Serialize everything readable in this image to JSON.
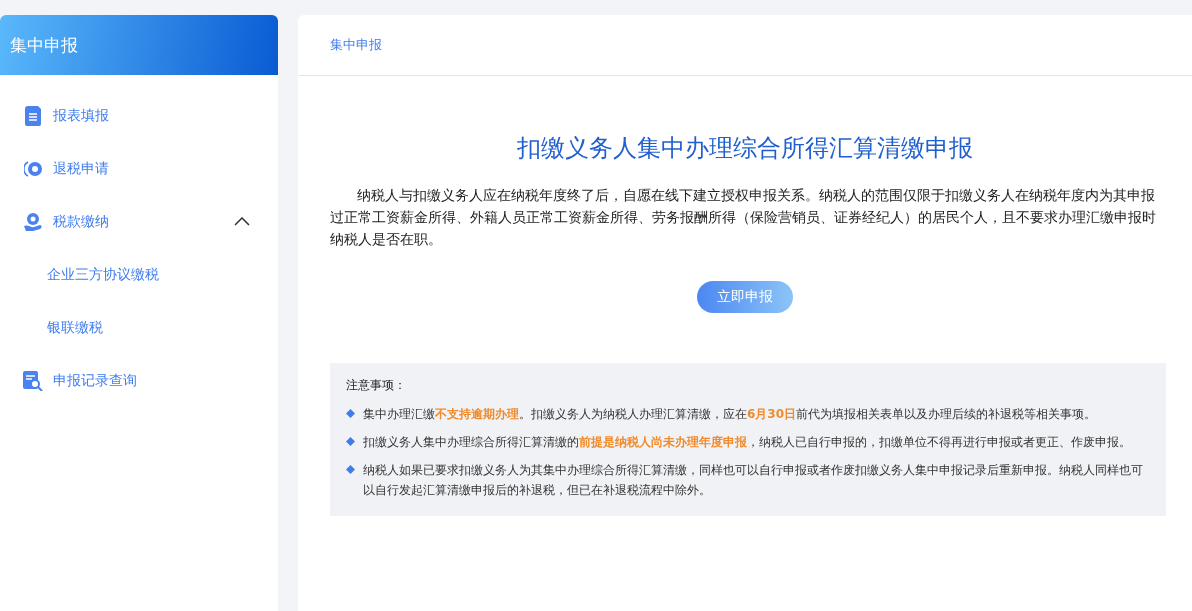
{
  "sidebar": {
    "title": "集中申报",
    "items": [
      {
        "label": "报表填报"
      },
      {
        "label": "退税申请"
      },
      {
        "label": "税款缴纳",
        "expanded": true,
        "children": [
          {
            "label": "企业三方协议缴税"
          },
          {
            "label": "银联缴税"
          }
        ]
      },
      {
        "label": "申报记录查询"
      }
    ]
  },
  "breadcrumb": "集中申报",
  "main": {
    "title": "扣缴义务人集中办理综合所得汇算清缴申报",
    "intro": "纳税人与扣缴义务人应在纳税年度终了后，自愿在线下建立授权申报关系。纳税人的范围仅限于扣缴义务人在纳税年度内为其申报过正常工资薪金所得、外籍人员正常工资薪金所得、劳务报酬所得（保险营销员、证券经纪人）的居民个人，且不要求办理汇缴申报时纳税人是否在职。",
    "button": "立即申报",
    "notice": {
      "title": "注意事项：",
      "items": [
        "集中办理汇缴**不支持逾期办理**。扣缴义务人为纳税人办理汇算清缴，应在**6月30日**前代为填报相关表单以及办理后续的补退税等相关事项。",
        "扣缴义务人集中办理综合所得汇算清缴的**前提是纳税人尚未办理年度申报**，纳税人已自行申报的，扣缴单位不得再进行申报或者更正、作废申报。",
        "纳税人如果已要求扣缴义务人为其集中办理综合所得汇算清缴，同样也可以自行申报或者作废扣缴义务人集中申报记录后重新申报。纳税人同样也可以自行发起汇算清缴申报后的补退税，但已在补退税流程中除外。"
      ]
    }
  }
}
